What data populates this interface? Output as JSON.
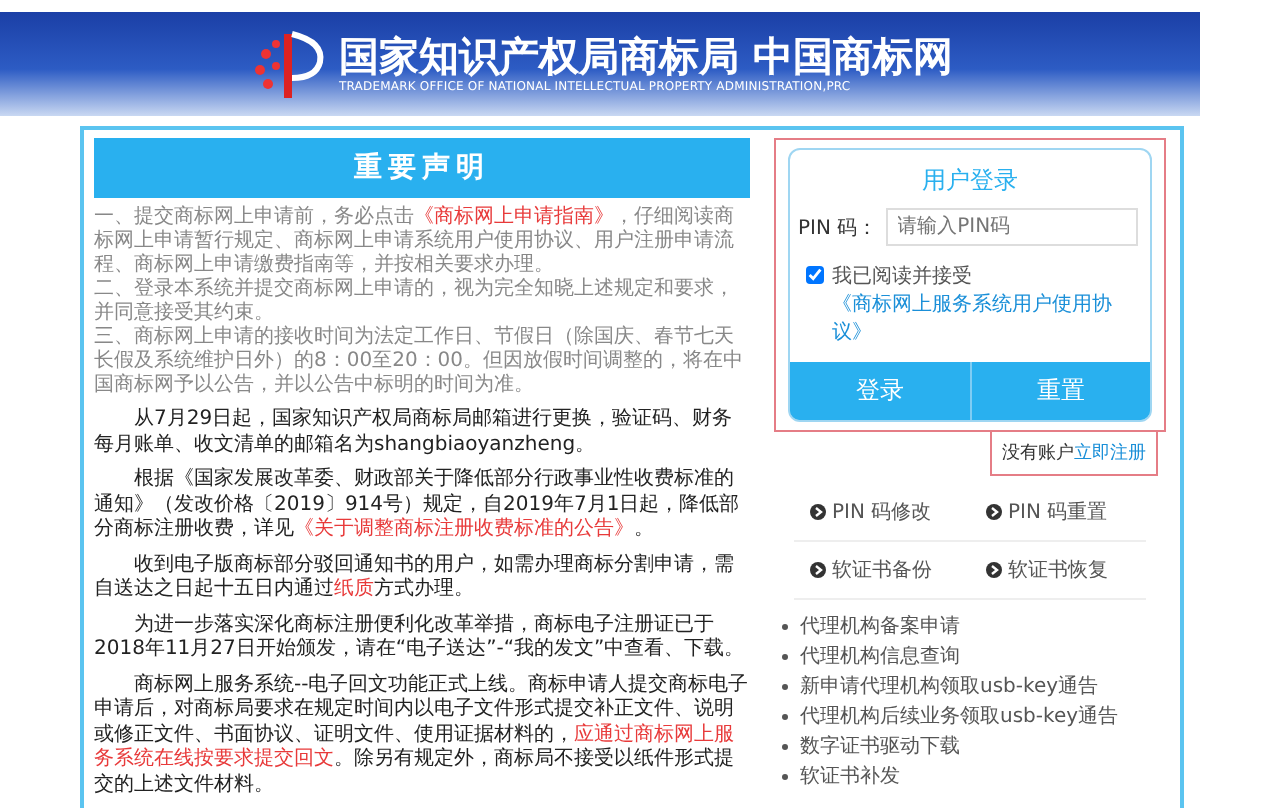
{
  "header": {
    "title": "国家知识产权局商标局 中国商标网",
    "subtitle": "TRADEMARK OFFICE OF NATIONAL INTELLECTUAL PROPERTY ADMINISTRATION,PRC"
  },
  "notice": {
    "title": "重要声明",
    "rules": [
      [
        {
          "kind": "plain",
          "text": "一、提交商标网上申请前，务必点击"
        },
        {
          "kind": "link",
          "text": "《商标网上申请指南》"
        },
        {
          "kind": "plain",
          "text": "，仔细阅读商标网上申请暂行规定、商标网上申请系统用户使用协议、用户注册申请流程、商标网上申请缴费指南等，并按相关要求办理。"
        }
      ],
      [
        {
          "kind": "plain",
          "text": "二、登录本系统并提交商标网上申请的，视为完全知晓上述规定和要求，并同意接受其约束。"
        }
      ],
      [
        {
          "kind": "plain",
          "text": "三、商标网上申请的接收时间为法定工作日、节假日（除国庆、春节七天长假及系统维护日外）的8：00至20：00。但因放假时间调整的，将在中国商标网予以公告，并以公告中标明的时间为准。"
        }
      ]
    ],
    "paragraphs": [
      [
        {
          "kind": "plain",
          "text": "从7月29日起，国家知识产权局商标局邮箱进行更换，验证码、财务每月账单、收文清单的邮箱名为shangbiaoyanzheng。"
        }
      ],
      [
        {
          "kind": "plain",
          "text": "根据《国家发展改革委、财政部关于降低部分行政事业性收费标准的通知》（发改价格〔2019〕914号）规定，自2019年7月1日起，降低部分商标注册收费，详见"
        },
        {
          "kind": "link",
          "text": "《关于调整商标注册收费标准的公告》"
        },
        {
          "kind": "plain",
          "text": "。"
        }
      ],
      [
        {
          "kind": "plain",
          "text": "收到电子版商标部分驳回通知书的用户，如需办理商标分割申请，需自送达之日起十五日内通过"
        },
        {
          "kind": "link",
          "text": "纸质"
        },
        {
          "kind": "plain",
          "text": "方式办理。"
        }
      ],
      [
        {
          "kind": "plain",
          "text": "为进一步落实深化商标注册便利化改革举措，商标电子注册证已于2018年11月27日开始颁发，请在“电子送达”-“我的发文”中查看、下载。"
        }
      ],
      [
        {
          "kind": "plain",
          "text": "商标网上服务系统--电子回文功能正式上线。商标申请人提交商标电子申请后，对商标局要求在规定时间内以电子文件形式提交补正文件、说明或修正文件、书面协议、证明文件、使用证据材料的，"
        },
        {
          "kind": "link",
          "text": "应通过商标网上服务系统在线按要求提交回文"
        },
        {
          "kind": "plain",
          "text": "。除另有规定外，商标局不接受以纸件形式提交的上述文件材料。"
        }
      ]
    ]
  },
  "login": {
    "title": "用户登录",
    "pin_label": "PIN 码：",
    "pin_placeholder": "请输入PIN码",
    "agree_checked": true,
    "agree_text": "我已阅读并接受",
    "agree_link": "《商标网上服务系统用户使用协议》",
    "buttons": [
      "登录",
      "重置"
    ]
  },
  "register": {
    "prompt": "没有账户",
    "link": "立即注册"
  },
  "tools": [
    "PIN 码修改",
    "PIN 码重置",
    "软证书备份",
    "软证书恢复"
  ],
  "links": [
    "代理机构备案申请",
    "代理机构信息查询",
    "新申请代理机构领取usb-key通告",
    "代理机构后续业务领取usb-key通告",
    "数字证书驱动下载",
    "软证书补发"
  ]
}
